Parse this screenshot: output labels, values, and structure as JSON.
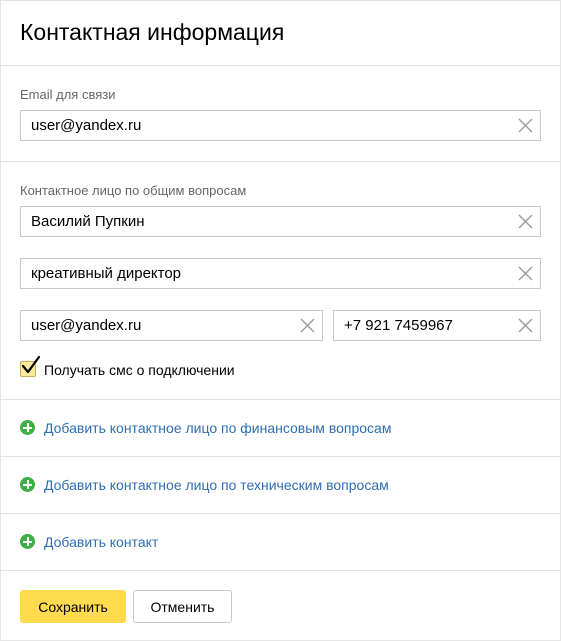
{
  "title": "Контактная информация",
  "email_section": {
    "label": "Email для связи",
    "email_value": "user@yandex.ru"
  },
  "contact_section": {
    "label": "Контактное лицо по общим вопросам",
    "name_value": "Василий Пупкин",
    "position_value": "креативный директор",
    "contact_email_value": "user@yandex.ru",
    "phone_value": "+7 921 7459967",
    "sms_checkbox": {
      "label": "Получать смс о подключении",
      "checked": true
    }
  },
  "add_links": {
    "finance": "Добавить контактное лицо по финансовым вопросам",
    "technical": "Добавить контактное лицо по техническим вопросам",
    "contact": "Добавить контакт"
  },
  "buttons": {
    "save": "Сохранить",
    "cancel": "Отменить"
  },
  "icons": {
    "clear": "close-icon",
    "add": "plus-circle-icon",
    "check": "checkmark-icon"
  },
  "colors": {
    "accent_button": "#ffdb4d",
    "link": "#2e6eb5",
    "add_icon": "#3fae46",
    "checkbox_fill": "#fde9a0"
  }
}
